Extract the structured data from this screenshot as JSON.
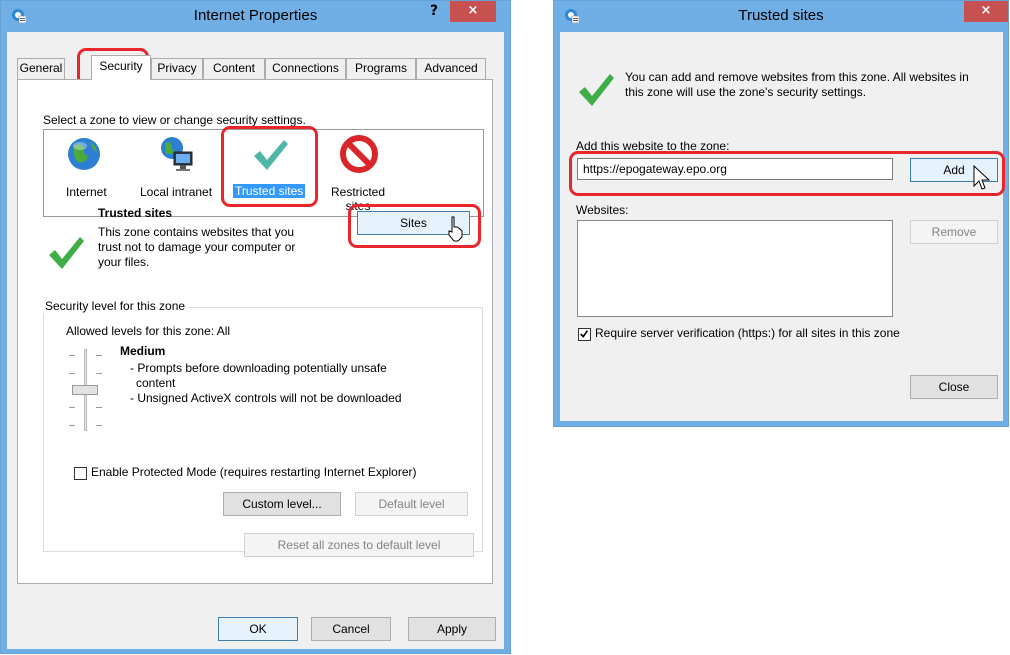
{
  "left_window": {
    "title": "Internet Properties",
    "help_label": "?",
    "close_label": "×",
    "tabs": [
      "General",
      "Security",
      "Privacy",
      "Content",
      "Connections",
      "Programs",
      "Advanced"
    ],
    "security": {
      "select_zone_label": "Select a zone to view or change security settings.",
      "zones": [
        "Internet",
        "Local intranet",
        "Trusted sites",
        "Restricted sites"
      ],
      "zone_title": "Trusted sites",
      "zone_description": [
        "This zone contains websites that you",
        "trust not to damage your computer or",
        "your files."
      ],
      "sites_button": "Sites",
      "security_level_group": "Security level for this zone",
      "allowed_levels": "Allowed levels for this zone: All",
      "level_name": "Medium",
      "level_desc": [
        "- Prompts before downloading potentially unsafe",
        "content",
        "- Unsigned ActiveX controls will not be downloaded"
      ],
      "protected_mode_label": "Enable Protected Mode (requires restarting Internet Explorer)",
      "custom_level_button": "Custom level...",
      "default_level_button": "Default level",
      "reset_all_button": "Reset all zones to default level"
    },
    "ok_button": "OK",
    "cancel_button": "Cancel",
    "apply_button": "Apply"
  },
  "right_window": {
    "title": "Trusted sites",
    "close_label": "×",
    "info_text": [
      "You can add and remove websites from this zone. All websites in",
      "this zone will use the zone's security settings."
    ],
    "add_label": "Add this website to the zone:",
    "url_value": "https://epogateway.epo.org",
    "add_button": "Add",
    "websites_label": "Websites:",
    "remove_button": "Remove",
    "require_verification_label": "Require server verification (https:) for all sites in this zone",
    "close_button": "Close"
  },
  "colors": {
    "titlebar": "#70aee6",
    "close": "#c75050",
    "highlight": "#e8262b",
    "selection": "#3399ff",
    "check_green": "#3fae49"
  },
  "icons": [
    "ie-icon",
    "globe-icon",
    "intranet-icon",
    "trusted-check-icon",
    "restricted-icon",
    "green-check-icon",
    "cursor-icon"
  ]
}
